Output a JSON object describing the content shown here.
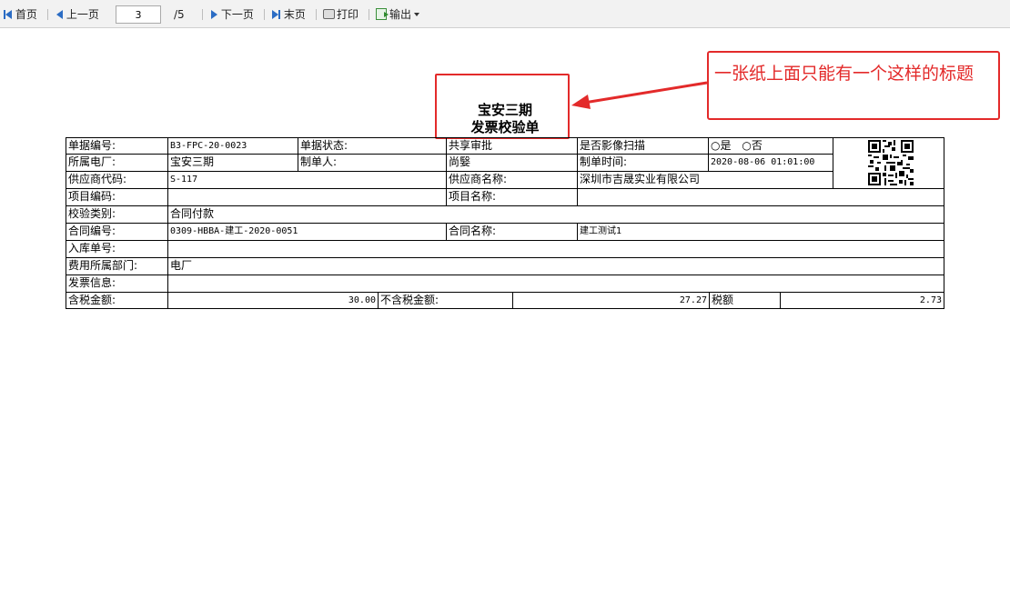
{
  "toolbar": {
    "first_label": "首页",
    "prev_label": "上一页",
    "page_value": "3",
    "page_total": "/5",
    "next_label": "下一页",
    "last_label": "末页",
    "print_label": "打印",
    "export_label": "输出"
  },
  "document": {
    "title_line1": "宝安三期",
    "title_line2": "发票校验单"
  },
  "annotation": {
    "text": "一张纸上面只能有一个这样的标题"
  },
  "form": {
    "doc_no_label": "单据编号:",
    "doc_no": "B3-FPC-20-0023",
    "doc_status_label": "单据状态:",
    "doc_status": "共享审批",
    "scan_label": "是否影像扫描",
    "scan_yes": "是",
    "scan_no": "否",
    "plant_label": "所属电厂:",
    "plant": "宝安三期",
    "creator_label": "制单人:",
    "creator": "尚嫛",
    "created_time_label": "制单时间:",
    "created_time": "2020-08-06 01:01:00",
    "supplier_code_label": "供应商代码:",
    "supplier_code": "S-117",
    "supplier_name_label": "供应商名称:",
    "supplier_name": "深圳市吉晟实业有限公司",
    "project_code_label": "项目编码:",
    "project_code": "",
    "project_name_label": "项目名称:",
    "project_name": "",
    "check_type_label": "校验类别:",
    "check_type": "合同付款",
    "contract_no_label": "合同编号:",
    "contract_no": "0309-HBBA-建工-2020-0051",
    "contract_name_label": "合同名称:",
    "contract_name": "建工测试1",
    "inbound_no_label": "入库单号:",
    "inbound_no": "",
    "expense_dept_label": "费用所属部门:",
    "expense_dept": "电厂",
    "invoice_info_label": "发票信息:",
    "invoice_info": "",
    "tax_incl_label": "含税金额:",
    "tax_incl": "30.00",
    "tax_excl_label": "不含税金额:",
    "tax_excl": "27.27",
    "tax_label": "税额",
    "tax": "2.73"
  },
  "colors": {
    "annotation_red": "#e32a2a",
    "nav_blue": "#2b6cc4"
  }
}
